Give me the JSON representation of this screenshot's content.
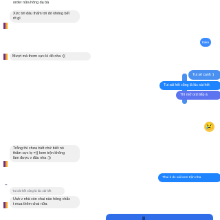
{
  "colors": {
    "outgoing": "#1e84ff",
    "incoming": "#f1f0f0",
    "text": "#1c1e21",
    "avatar": "#6d2f8a"
  },
  "messages": [
    {
      "id": "m1",
      "side": "in",
      "lines": [
        "order nữa hông dạ bà"
      ]
    },
    {
      "id": "m2",
      "side": "in",
      "lines": [
        "Xức tới đâu thấm tới đó không bết",
        "rít gì"
      ]
    },
    {
      "id": "m3",
      "side": "out",
      "text": "Kaku"
    },
    {
      "id": "m4",
      "side": "in",
      "lines": [
        "Mượt mà thơm cực kì đó nha :(("
      ]
    },
    {
      "id": "m5",
      "side": "out",
      "text": "Tui sẽ canh :)"
    },
    {
      "id": "m6",
      "side": "out",
      "text": "Tui xài hết cũng là lúc xài hết"
    },
    {
      "id": "m7",
      "side": "out",
      "text": "Thì mở ord tiếp á"
    },
    {
      "id": "m8",
      "side": "in",
      "emoji": "😢"
    },
    {
      "id": "m9",
      "side": "in",
      "lines": [
        "Trắng thì chưa biết chứ biết nó",
        "thẩm cực lẹ =)) kem trộn không",
        "làm được v đâu nha :))"
      ]
    },
    {
      "id": "m10",
      "side": "out",
      "text": "Thui k dc xài kem trộn nha"
    },
    {
      "id": "m11",
      "side": "in",
      "lines": [
        "Tui xài hết cũng là lúc xài hết"
      ],
      "quoted": true
    },
    {
      "id": "m12",
      "side": "in",
      "lines": [
        "Uah v nhà còn chai nào hông chắc",
        "t mua thêm chai nữa"
      ]
    }
  ]
}
